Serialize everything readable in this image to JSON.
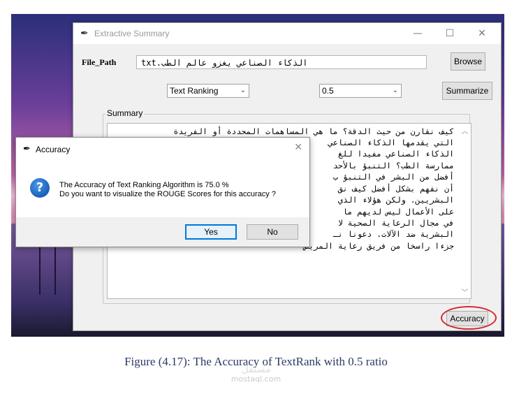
{
  "desktop": {
    "background": "pink-purple sunset wallpaper"
  },
  "main_window": {
    "title": "Extractive Summary",
    "controls": {
      "minimize": "—",
      "maximize": "☐",
      "close": "✕"
    },
    "file_path_label": "File_Path",
    "file_path_value": "الذكاء الصناعي يغزو عالم الطب.txt",
    "browse_label": "Browse",
    "algorithm_select": "Text Ranking",
    "ratio_select": "0.5",
    "summarize_label": "Summarize",
    "summary_group_label": "Summary",
    "summary_lines": [
      "كيف نقارن من حيث الدقة؟ ما هي المساهمات المحددة أو الفريدة",
      "التي يقدمها الذكاء الصناعي",
      "الذكاء الصناعي مفيدا للغ",
      "ممارسة الطب؟ التنبؤ بالأحد",
      "أفضل من البشر في التنبؤ ب",
      "أن نفهم بشكل أفضل كيف نق",
      "البشريين. ولكن هؤلاء الذي",
      "على الأعمال ليس لديهم ما",
      "في مجال الرعاية الصحية لا",
      "البشرية ضد الآلات. دعونا نـ",
      "جزءا راسخا من فريق رعاية المريض"
    ],
    "accuracy_label": "Accuracy"
  },
  "dialog": {
    "title": "Accuracy",
    "icon": "question-icon",
    "message_line1": "The Accuracy of Text Ranking Algorithm is 75.0 %",
    "message_line2": "Do you want to visualize the ROUGE Scores for this accuracy ?",
    "yes_label": "Yes",
    "no_label": "No",
    "close": "✕"
  },
  "caption": "Figure (4.17): The Accuracy of TextRank with 0.5 ratio",
  "watermark": {
    "arabic": "مستقل",
    "latin": "mostaql.com"
  },
  "colors": {
    "highlight_circle": "#d7262c",
    "caption": "#2a3a66",
    "focus": "#0078d7"
  }
}
